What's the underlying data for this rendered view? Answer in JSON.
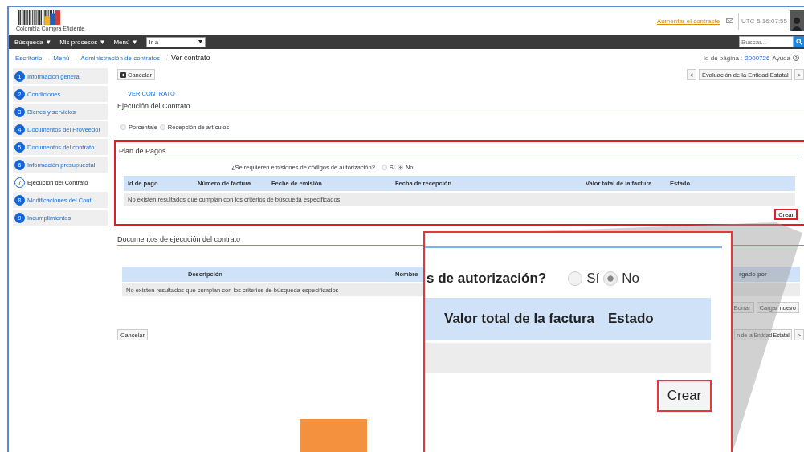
{
  "header": {
    "logo_text": "Colombia Compra Eficiente",
    "contrast_link": "Aumentar el contraste",
    "clock": "UTC-5 16:07:55"
  },
  "nav": {
    "menus": [
      "Búsqueda ▼",
      "Mis procesos ▼",
      "Menú ▼"
    ],
    "goto_select": "Ir a",
    "search_placeholder": "Buscar..."
  },
  "breadcrumb": {
    "items": [
      "Escritorio",
      "Menú",
      "Administración de contratos"
    ],
    "separator": "→",
    "current": "Ver contrato",
    "page_id_label": "Id de página :",
    "page_id": "2000726",
    "help": "Ayuda"
  },
  "steps": [
    {
      "number": "1",
      "label": "Información general",
      "selected": false
    },
    {
      "number": "2",
      "label": "Condiciones",
      "selected": false
    },
    {
      "number": "3",
      "label": "Bienes y servicios",
      "selected": false
    },
    {
      "number": "4",
      "label": "Documentos del Proveedor",
      "selected": false
    },
    {
      "number": "5",
      "label": "Documentos del contrato",
      "selected": false
    },
    {
      "number": "6",
      "label": "Información presupuestal",
      "selected": false
    },
    {
      "number": "7",
      "label": "Ejecución del Contrato",
      "selected": true
    },
    {
      "number": "8",
      "label": "Modificaciones del Cont...",
      "selected": false
    },
    {
      "number": "9",
      "label": "Incumplimientos",
      "selected": false
    }
  ],
  "toolbar": {
    "cancel": "Cancelar",
    "prev": "<",
    "next_title": "Evaluación de la Entidad Estatal",
    "next": ">"
  },
  "section_crumb": "VER CONTRATO",
  "section_title": "Ejecución del Contrato",
  "execution_options": [
    {
      "label": "Porcentaje",
      "selected": false
    },
    {
      "label": "Recepción de artículos",
      "selected": false
    }
  ],
  "payment_plan": {
    "title": "Plan de Pagos",
    "question": "¿Se requieren emisiones de códigos de autorización?",
    "options": [
      {
        "label": "Sí",
        "selected": false
      },
      {
        "label": "No",
        "selected": true
      }
    ],
    "columns": [
      "Id de pago",
      "Número de factura",
      "Fecha de emisión",
      "Fecha de recepción",
      "Valor total de la factura",
      "Estado"
    ],
    "empty_message": "No existen resultados que cumplan con los criterios de búsqueda especificados",
    "create_button": "Crear"
  },
  "documents": {
    "title": "Documentos de ejecución del contrato",
    "columns": [
      "Descripción",
      "Nombre",
      "rgado por"
    ],
    "empty_message": "No existen resultados que cumplan con los criterios de búsqueda especificados",
    "buttons": [
      "Borrar",
      "Cargar nuevo"
    ]
  },
  "footer": {
    "cancel": "Cancelar",
    "next_title": "n de la Entidad Estatal",
    "next": ">"
  },
  "callout": {
    "question": "s de autorización?",
    "options": [
      {
        "label": "Sí",
        "selected": false
      },
      {
        "label": "No",
        "selected": true
      }
    ],
    "columns": [
      "Valor total de la factura",
      "Estado"
    ],
    "create_button": "Crear"
  }
}
